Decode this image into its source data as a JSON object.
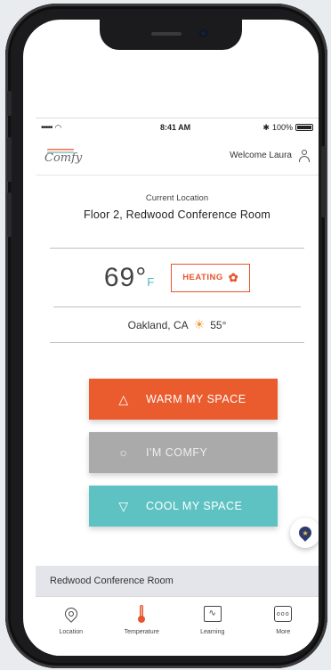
{
  "status_bar": {
    "signal": "•••••",
    "wifi": "wifi-icon",
    "time": "8:41 AM",
    "bluetooth": "✱",
    "battery_pct": "100%"
  },
  "header": {
    "logo_text": "Comfy",
    "welcome": "Welcome Laura"
  },
  "location": {
    "label": "Current Location",
    "name": "Floor 2, Redwood Conference Room"
  },
  "thermostat": {
    "temperature": "69°",
    "unit": "F",
    "mode_label": "HEATING",
    "mode_color": "#e8542e"
  },
  "weather": {
    "city": "Oakland, CA",
    "temp": "55°",
    "icon": "sun-icon"
  },
  "actions": {
    "warm_label": "WARM MY SPACE",
    "comfy_label": "I'M COMFY",
    "cool_label": "COOL MY SPACE",
    "warm_color": "#ea5b2d",
    "comfy_color": "#aaaaaa",
    "cool_color": "#5ec2c3"
  },
  "room_bar": {
    "name": "Redwood Conference Room"
  },
  "tabs": [
    {
      "label": "Location",
      "icon": "location-pin-icon"
    },
    {
      "label": "Temperature",
      "icon": "thermometer-icon"
    },
    {
      "label": "Learning",
      "icon": "activity-graph-icon"
    },
    {
      "label": "More",
      "icon": "more-dots-icon"
    }
  ]
}
